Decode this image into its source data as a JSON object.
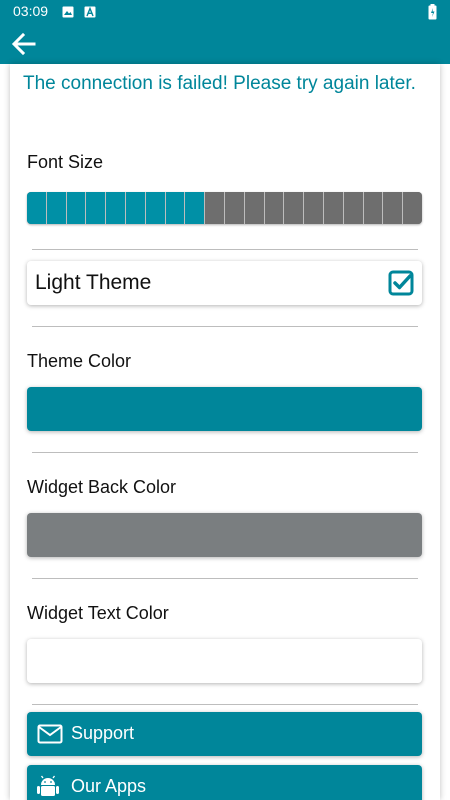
{
  "status_bar": {
    "time": "03:09",
    "icons": [
      "image-icon",
      "font-icon",
      "battery-icon"
    ]
  },
  "app_bar": {
    "back_icon": "arrow-left-icon"
  },
  "settings": {
    "error_message": "The connection is failed! Please try again later.",
    "font_size": {
      "label": "Font Size",
      "level": 9,
      "max": 20
    },
    "light_theme": {
      "label": "Light Theme",
      "checked": true
    },
    "theme_color": {
      "label": "Theme Color",
      "value": "#00869a"
    },
    "widget_back_color": {
      "label": "Widget Back Color",
      "value": "#7a7e80"
    },
    "widget_text_color": {
      "label": "Widget Text Color",
      "value": "#ffffff"
    },
    "support_button": {
      "label": "Support",
      "icon": "envelope-icon"
    },
    "our_apps_button": {
      "label": "Our Apps",
      "icon": "android-icon"
    }
  },
  "colors": {
    "accent": "#00869a",
    "segment_off": "#6e6e6e",
    "divider": "#bdbdbd"
  }
}
